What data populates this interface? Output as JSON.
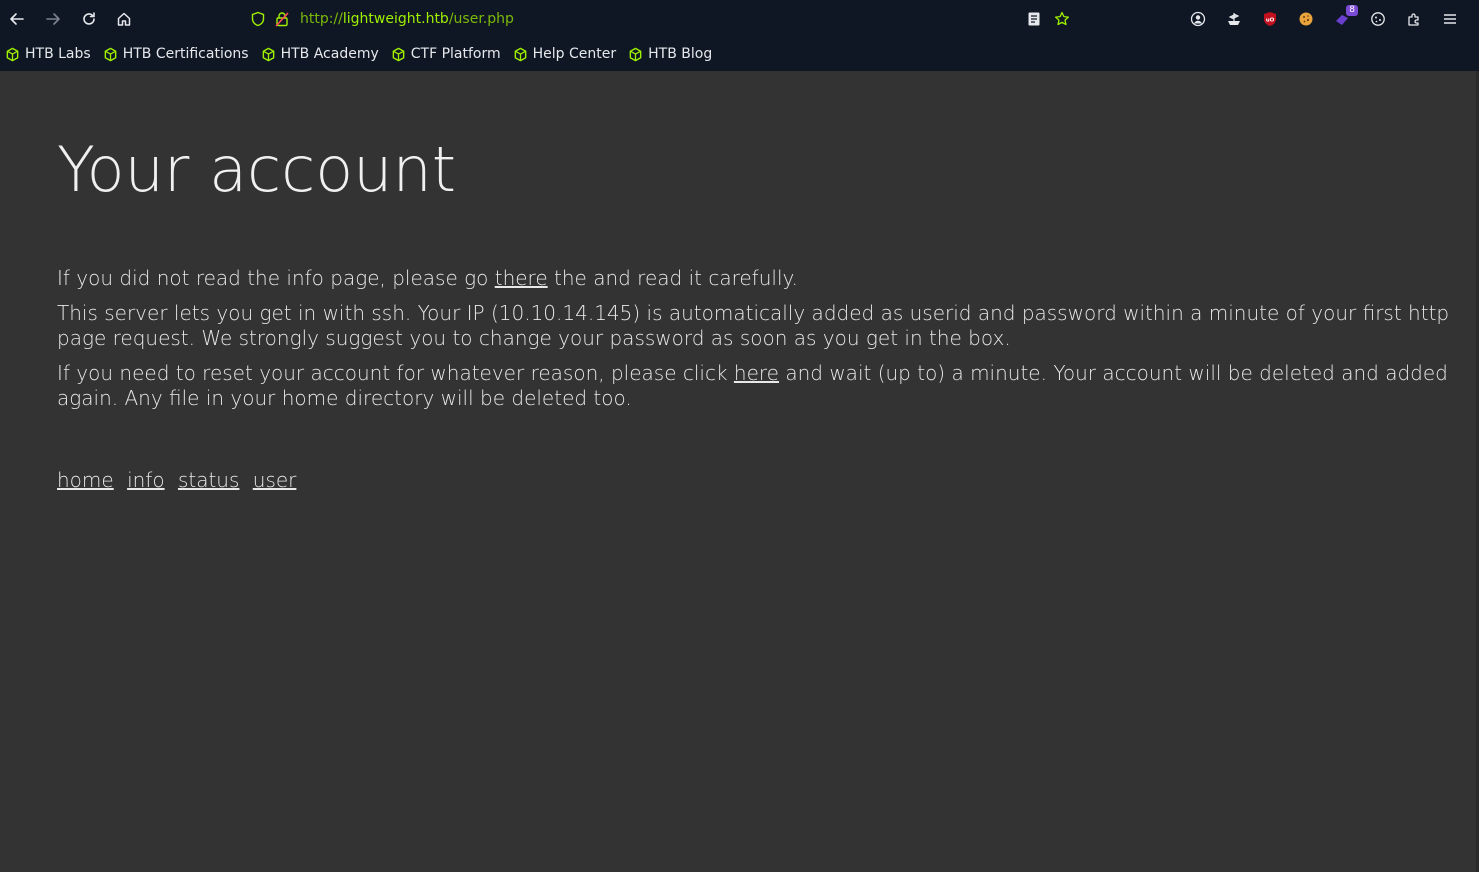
{
  "browser": {
    "url_scheme": "http://",
    "url_host": "lightweight.htb",
    "url_path": "/user.php",
    "extension_badge": "8",
    "bookmarks": [
      {
        "label": "HTB Labs"
      },
      {
        "label": "HTB Certifications"
      },
      {
        "label": "HTB Academy"
      },
      {
        "label": "CTF Platform"
      },
      {
        "label": "Help Center"
      },
      {
        "label": "HTB Blog"
      }
    ],
    "accent_color": "#9fef00"
  },
  "page": {
    "title": "Your account",
    "p1_before": "If you did not read the info page, please go ",
    "p1_link": "there",
    "p1_after": " the and read it carefully.",
    "p2": "This server lets you get in with ssh. Your IP (10.10.14.145) is automatically added as userid and password within a minute of your first http page request. We strongly suggest you to change your password as soon as you get in the box.",
    "p3_before": "If you need to reset your account for whatever reason, please click ",
    "p3_link": "here",
    "p3_after": " and wait (up to) a minute. Your account will be deleted and added again. Any file in your home directory will be deleted too.",
    "nav": [
      {
        "label": "home"
      },
      {
        "label": "info"
      },
      {
        "label": "status"
      },
      {
        "label": "user"
      }
    ],
    "background_color": "#333333"
  }
}
